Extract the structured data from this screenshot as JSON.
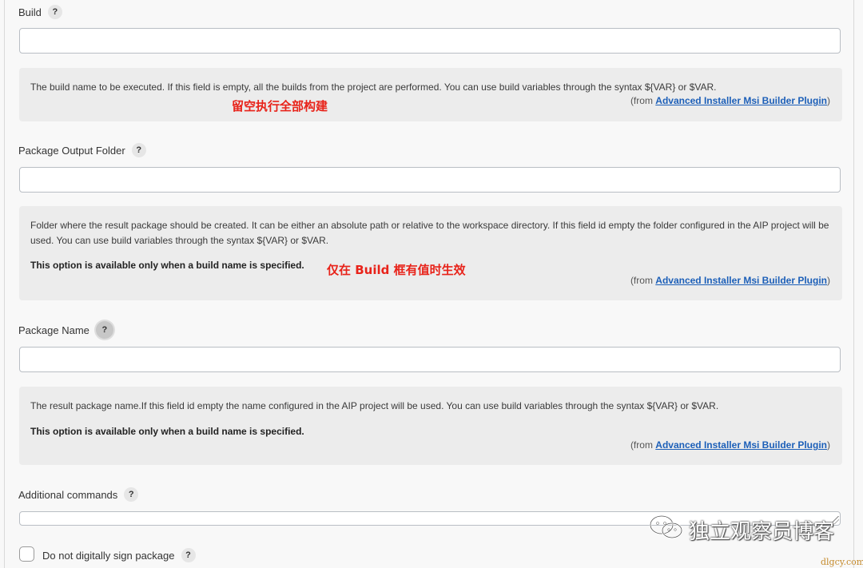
{
  "fields": {
    "build": {
      "label": "Build",
      "help_icon": "?",
      "value": "",
      "help": "The build name to be executed. If this field is empty, all the builds from the project are performed. You can use build variables through the syntax ${VAR} or $VAR.",
      "annotation": "留空执行全部构建"
    },
    "output_folder": {
      "label": "Package Output Folder",
      "help_icon": "?",
      "value": "",
      "help": "Folder where the result package should be created. It can be either an absolute path or relative to the workspace directory. If this field id empty the folder configured in the AIP project will be used. You can use build variables through the syntax ${VAR} or $VAR.",
      "note": "This option is available only when a build name is specified.",
      "annotation": "仅在 Build 框有值时生效"
    },
    "package_name": {
      "label": "Package Name",
      "help_icon": "?",
      "value": "",
      "help": "The result package name.If this field id empty the name configured in the AIP project will be used. You can use build variables through the syntax ${VAR} or $VAR.",
      "note": "This option is available only when a build name is specified."
    },
    "additional_commands": {
      "label": "Additional commands",
      "help_icon": "?",
      "value": ""
    },
    "no_sign": {
      "label": "Do not digitally sign package",
      "help_icon": "?",
      "checked": false
    }
  },
  "plugin": {
    "from_prefix": "(from ",
    "name": "Advanced Installer Msi Builder Plugin",
    "from_suffix": ")"
  },
  "watermark": {
    "text": "独立观察员博客",
    "icon": "wechat-icon",
    "site": "dlgcy.com"
  },
  "colors": {
    "link": "#1c5fb8",
    "annotation": "#e8231a",
    "helpbox_bg": "#ececec"
  }
}
